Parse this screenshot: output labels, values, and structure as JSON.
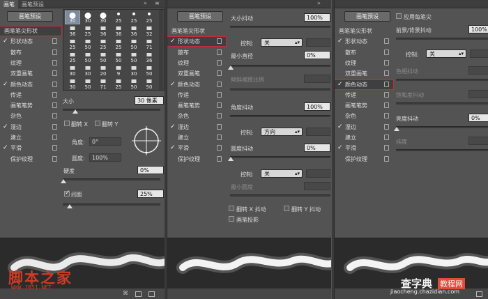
{
  "panel1": {
    "tabs": [
      "画笔",
      "画笔预设"
    ],
    "preset_button": "画笔预设",
    "sidebar": [
      {
        "label": "画笔笔尖形状",
        "checked": false,
        "lock": false
      },
      {
        "label": "形状动态",
        "checked": true,
        "lock": true
      },
      {
        "label": "散布",
        "checked": false,
        "lock": true
      },
      {
        "label": "纹理",
        "checked": false,
        "lock": true
      },
      {
        "label": "双重画笔",
        "checked": false,
        "lock": true
      },
      {
        "label": "颜色动态",
        "checked": true,
        "lock": true
      },
      {
        "label": "传递",
        "checked": false,
        "lock": true
      },
      {
        "label": "画笔笔势",
        "checked": false,
        "lock": true
      },
      {
        "label": "杂色",
        "checked": false,
        "lock": true
      },
      {
        "label": "湿边",
        "checked": true,
        "lock": true
      },
      {
        "label": "建立",
        "checked": false,
        "lock": true
      },
      {
        "label": "平滑",
        "checked": true,
        "lock": true
      },
      {
        "label": "保护纹理",
        "checked": false,
        "lock": true
      }
    ],
    "brush_rows": [
      [
        "30",
        "30",
        "30",
        "25",
        "25",
        "25"
      ],
      [
        "36",
        "25",
        "36",
        "36",
        "36",
        "32"
      ],
      [
        "25",
        "50",
        "25",
        "25",
        "50",
        "71"
      ],
      [
        "25",
        "50",
        "50",
        "50",
        "50",
        "36"
      ],
      [
        "30",
        "30",
        "20",
        "9",
        "30",
        "50"
      ],
      [
        "30",
        "50",
        "71",
        "25",
        "50",
        "50"
      ]
    ],
    "size_label": "大小",
    "size_value": "30 像素",
    "flip_x": "翻转 X",
    "flip_y": "翻转 Y",
    "angle_label": "角度:",
    "angle_value": "0°",
    "roundness_label": "圆度:",
    "roundness_value": "100%",
    "hardness_label": "硬度",
    "hardness_value": "0%",
    "spacing_label": "间距",
    "spacing_value": "25%"
  },
  "panel2": {
    "preset_button": "画笔预设",
    "sidebar": [
      {
        "label": "画笔笔尖形状",
        "checked": false,
        "lock": false
      },
      {
        "label": "形状动态",
        "checked": true,
        "lock": true
      },
      {
        "label": "散布",
        "checked": false,
        "lock": true
      },
      {
        "label": "纹理",
        "checked": false,
        "lock": true
      },
      {
        "label": "双重画笔",
        "checked": false,
        "lock": true
      },
      {
        "label": "颜色动态",
        "checked": true,
        "lock": true
      },
      {
        "label": "传递",
        "checked": false,
        "lock": true
      },
      {
        "label": "画笔笔势",
        "checked": false,
        "lock": true
      },
      {
        "label": "杂色",
        "checked": false,
        "lock": true
      },
      {
        "label": "湿边",
        "checked": true,
        "lock": true
      },
      {
        "label": "建立",
        "checked": false,
        "lock": true
      },
      {
        "label": "平滑",
        "checked": true,
        "lock": true
      },
      {
        "label": "保护纹理",
        "checked": false,
        "lock": true
      }
    ],
    "size_jitter_label": "大小抖动",
    "size_jitter_value": "100%",
    "control_label": "控制:",
    "control_off": "关",
    "min_diameter_label": "最小直径",
    "min_diameter_value": "0%",
    "tilt_scale_label": "倾斜缩放比例",
    "angle_jitter_label": "角度抖动",
    "angle_jitter_value": "100%",
    "control_direction": "方向",
    "roundness_jitter_label": "圆度抖动",
    "roundness_jitter_value": "0%",
    "min_roundness_label": "最小圆度",
    "flip_x_jitter": "翻转 X 抖动",
    "flip_y_jitter": "翻转 Y 抖动",
    "brush_projection": "画笔投影"
  },
  "panel3": {
    "preset_button": "画笔预设",
    "sidebar": [
      {
        "label": "画笔笔尖形状",
        "checked": false,
        "lock": false
      },
      {
        "label": "形状动态",
        "checked": true,
        "lock": true
      },
      {
        "label": "散布",
        "checked": false,
        "lock": true
      },
      {
        "label": "纹理",
        "checked": false,
        "lock": true
      },
      {
        "label": "双重画笔",
        "checked": false,
        "lock": true
      },
      {
        "label": "颜色动态",
        "checked": true,
        "lock": true
      },
      {
        "label": "传递",
        "checked": false,
        "lock": true
      },
      {
        "label": "画笔笔势",
        "checked": false,
        "lock": true
      },
      {
        "label": "杂色",
        "checked": false,
        "lock": true
      },
      {
        "label": "湿边",
        "checked": true,
        "lock": true
      },
      {
        "label": "建立",
        "checked": false,
        "lock": true
      },
      {
        "label": "平滑",
        "checked": true,
        "lock": true
      },
      {
        "label": "保护纹理",
        "checked": false,
        "lock": true
      }
    ],
    "apply_per_tip": "应用每笔尖",
    "fg_bg_jitter_label": "前景/背景抖动",
    "fg_bg_jitter_value": "100%",
    "control_label": "控制:",
    "control_off": "关",
    "hue_jitter_label": "色相抖动",
    "saturation_jitter_label": "饱和度抖动",
    "brightness_jitter_label": "亮度抖动",
    "brightness_jitter_value": "0%",
    "purity_label": "纯度"
  },
  "watermarks": {
    "left_big": "脚本之家",
    "left_small": "WWW.JB51.NET",
    "right_big": "查字典",
    "right_mid": "教程网",
    "right_small": "jiaocheng.chazidian.com"
  }
}
